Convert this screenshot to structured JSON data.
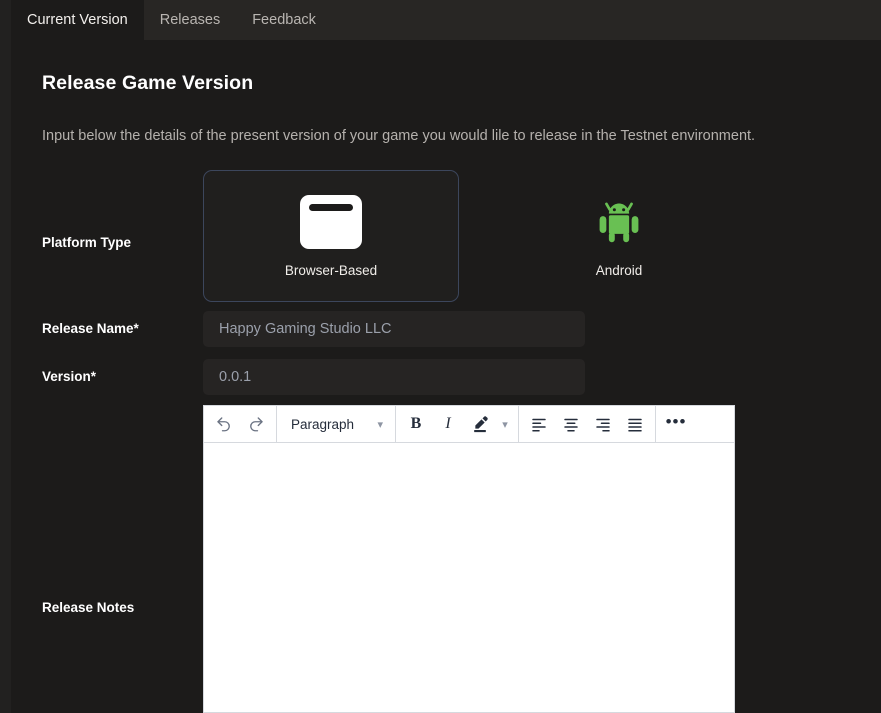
{
  "tabs": [
    {
      "label": "Current Version",
      "active": true
    },
    {
      "label": "Releases",
      "active": false
    },
    {
      "label": "Feedback",
      "active": false
    }
  ],
  "page": {
    "title": "Release Game Version",
    "description": "Input below the details of the present version of your game you would lile to release in the Testnet environment."
  },
  "form": {
    "platform": {
      "label": "Platform Type",
      "options": [
        {
          "label": "Browser-Based",
          "icon": "browser-window-icon",
          "selected": true
        },
        {
          "label": "Android",
          "icon": "android-robot-icon",
          "selected": false
        }
      ],
      "selected_border_color": "#3c465c"
    },
    "release_name": {
      "label": "Release Name*",
      "value": "",
      "placeholder": "Happy Gaming Studio LLC"
    },
    "version": {
      "label": "Version*",
      "value": "",
      "placeholder": "0.0.1"
    },
    "release_notes": {
      "label": "Release Notes",
      "value": "",
      "toolbar": {
        "undo": "undo-icon",
        "redo": "redo-icon",
        "block_format": "Paragraph",
        "bold": "B",
        "italic": "I",
        "highlight": "highlighter-pen-icon",
        "align_left": "align-left-icon",
        "align_center": "align-center-icon",
        "align_right": "align-right-icon",
        "align_justify": "align-justify-icon",
        "more": "•••"
      }
    }
  },
  "colors": {
    "background": "#1c1b1a",
    "tabbar": "#282624",
    "input": "#262423",
    "android_green": "#69c053",
    "editor_text": "#252d3b"
  }
}
